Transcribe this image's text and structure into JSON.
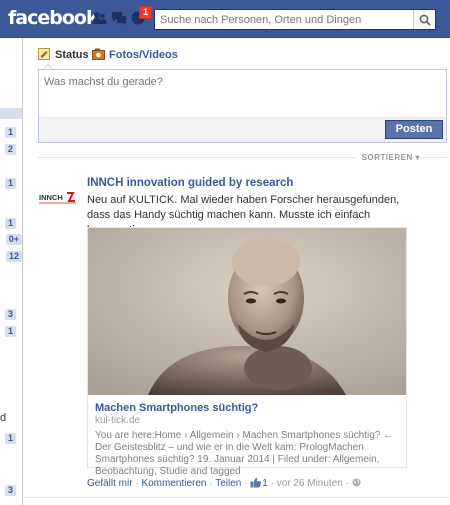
{
  "header": {
    "logo": "facebook",
    "notification_count": "1",
    "search_placeholder": "Suche nach Personen, Orten und Dingen",
    "colors": {
      "bar": "#3b5998",
      "badge": "#f03d25"
    }
  },
  "left_rail": {
    "counts": [
      "1",
      "2",
      "1",
      "1",
      "0+",
      "12",
      "3",
      "1",
      "1",
      "3"
    ],
    "fragment_d": "d"
  },
  "composer": {
    "tab_status": "Status",
    "tab_photos": "Fotos/Videos",
    "placeholder": "Was machst du gerade?",
    "post_button": "Posten"
  },
  "feed": {
    "sort_label": "SORTIEREN ▾"
  },
  "story": {
    "author": "INNCH innovation guided by research",
    "message": "Neu auf KULTICK. Mal wieder haben Forscher herausgefunden, dass das Handy süchtig machen kann. Musste ich einfach kommentieren...",
    "avatar_text": "INNCH",
    "share": {
      "title": "Machen Smartphones süchtig?",
      "domain": "kul-tick.de",
      "description": "You are here:Home › Allgemein › Machen Smartphones süchtig? ← Der Geistesblitz – und wie er in die Welt kam: PrologMachen Smartphones süchtig? 19. Januar 2014 | Filed under: Allgemein, Beobachtung, Studie and tagged"
    },
    "actions": {
      "like": "Gefällt mir",
      "comment": "Kommentieren",
      "share": "Teilen",
      "like_count": "1",
      "time": "vor 26 Minuten"
    }
  }
}
